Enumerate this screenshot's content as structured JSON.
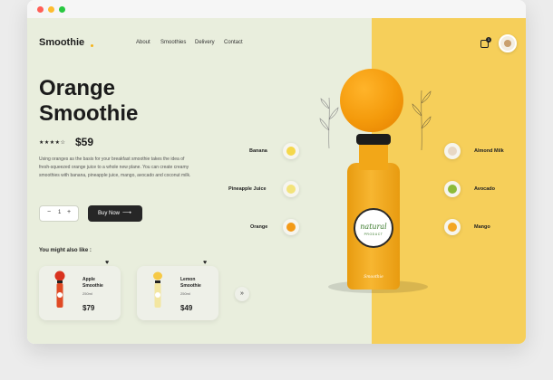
{
  "header": {
    "logo": "Smoothie",
    "nav": [
      "About",
      "Smoothies",
      "Delivery",
      "Contact"
    ],
    "cart_count": "1"
  },
  "product": {
    "title_line1": "Orange",
    "title_line2": "Smoothie",
    "rating_stars": "★★★★☆",
    "rating_value": 4,
    "rating_max": 5,
    "price": "$59",
    "description": "Using oranges as the basis for your breakfast smoothie takes the idea of fresh-squeezed orange juice to a whole new plane. You can create creamy smoothies with banana, pineapple juice, mango, avocado and coconut milk.",
    "quantity": "1",
    "buy_label": "Buy Now"
  },
  "bottle": {
    "label_top": "natural",
    "label_bottom": "PRODUCT",
    "brand": "Smoothie"
  },
  "ingredients_left": [
    {
      "label": "Banana",
      "icon": "banana-icon",
      "color": "#f5d84b"
    },
    {
      "label": "Pineapple Juice",
      "icon": "pineapple-juice-icon",
      "color": "#f3e37a"
    },
    {
      "label": "Orange",
      "icon": "orange-icon",
      "color": "#f39a17"
    }
  ],
  "ingredients_right": [
    {
      "label": "Almond Milk",
      "icon": "almond-milk-icon",
      "color": "#e8d8c4"
    },
    {
      "label": "Avocado",
      "icon": "avocado-icon",
      "color": "#8dbb3a"
    },
    {
      "label": "Mango",
      "icon": "mango-icon",
      "color": "#f3a623"
    }
  ],
  "also": {
    "heading": "You might also like :",
    "items": [
      {
        "name": "Apple Smoothie",
        "volume": "250ml",
        "price": "$79",
        "color": "#d9331f"
      },
      {
        "name": "Lemon Smoothie",
        "volume": "250ml",
        "price": "$49",
        "color": "#f6c945"
      }
    ]
  },
  "colors": {
    "page_bg": "#e9eedd",
    "accent_yellow": "#f6cf5a",
    "dark": "#262626"
  }
}
